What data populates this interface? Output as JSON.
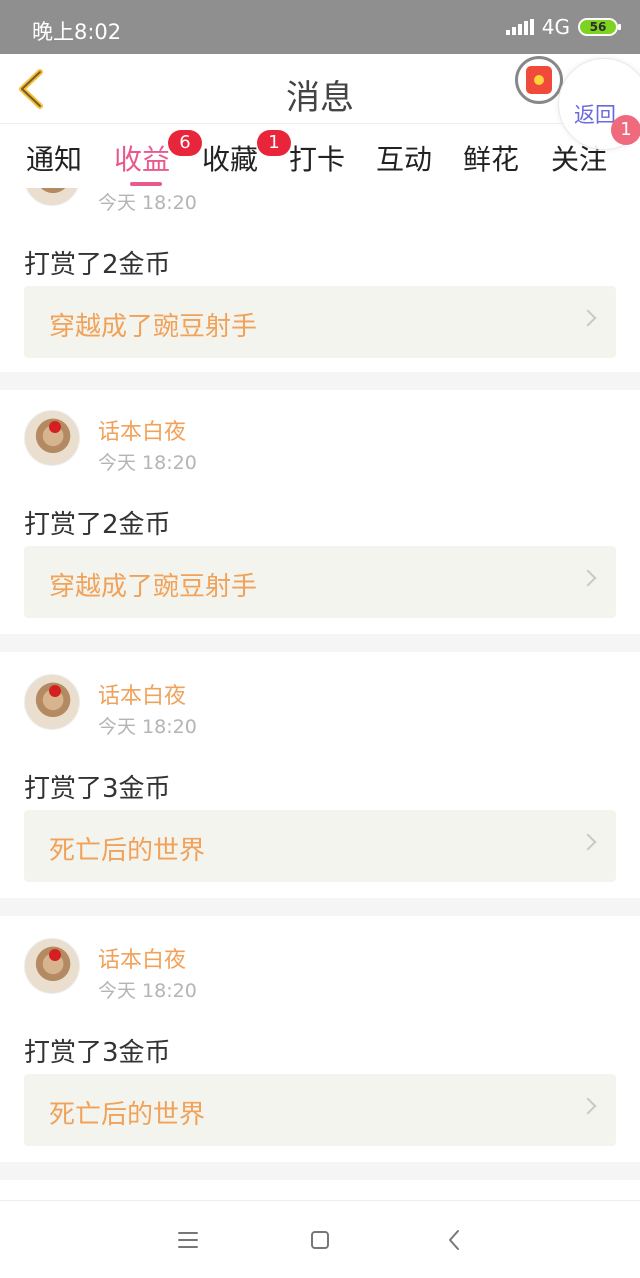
{
  "status_bar": {
    "time": "晚上8:02",
    "network": "4G",
    "battery": "56"
  },
  "header": {
    "title": "消息",
    "float_return_label": "返回",
    "float_badge": "1"
  },
  "tabs": [
    {
      "label": "通知",
      "active": false
    },
    {
      "label": "收益",
      "active": true,
      "badge": "6"
    },
    {
      "label": "收藏",
      "active": false,
      "badge": "1"
    },
    {
      "label": "打卡",
      "active": false
    },
    {
      "label": "互动",
      "active": false
    },
    {
      "label": "鲜花",
      "active": false
    },
    {
      "label": "关注",
      "active": false
    }
  ],
  "feed": [
    {
      "name": "",
      "time": "今天 18:20",
      "action": "打赏了2金币",
      "book": "穿越成了豌豆射手"
    },
    {
      "name": "话本白夜",
      "time": "今天 18:20",
      "action": "打赏了2金币",
      "book": "穿越成了豌豆射手"
    },
    {
      "name": "话本白夜",
      "time": "今天 18:20",
      "action": "打赏了3金币",
      "book": "死亡后的世界"
    },
    {
      "name": "话本白夜",
      "time": "今天 18:20",
      "action": "打赏了3金币",
      "book": "死亡后的世界"
    }
  ],
  "nav": {
    "menu": "menu-icon",
    "home": "home-icon",
    "back": "back-icon"
  },
  "colors": {
    "accent": "#e85a8e",
    "orange": "#f0a25a",
    "badge": "#e8253a",
    "book_bg": "#f4f4ee"
  }
}
